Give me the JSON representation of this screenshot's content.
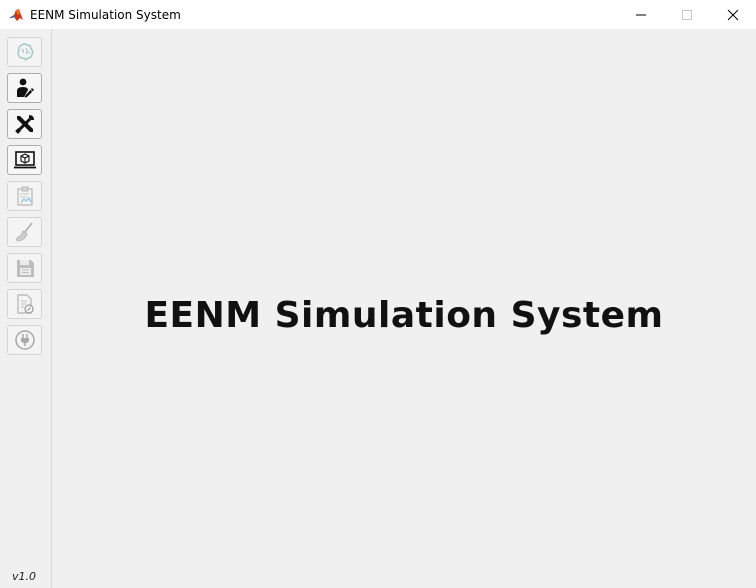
{
  "window": {
    "title": "EENM Simulation System",
    "app_icon": "matlab-icon",
    "controls": [
      "minimize-icon",
      "maximize-icon",
      "close-icon"
    ]
  },
  "toolbar": {
    "buttons": [
      {
        "icon": "brain-icon",
        "enabled": false
      },
      {
        "icon": "user-edit-icon",
        "enabled": true
      },
      {
        "icon": "tools-icon",
        "enabled": true
      },
      {
        "icon": "monitor-3d-icon",
        "enabled": true
      },
      {
        "icon": "clipboard-chart-icon",
        "enabled": false
      },
      {
        "icon": "broom-icon",
        "enabled": false
      },
      {
        "icon": "save-icon",
        "enabled": false
      },
      {
        "icon": "document-settings-icon",
        "enabled": false
      },
      {
        "icon": "power-plug-icon",
        "enabled": false
      }
    ]
  },
  "version": "v1.0",
  "main": {
    "title": "EENM Simulation System"
  }
}
